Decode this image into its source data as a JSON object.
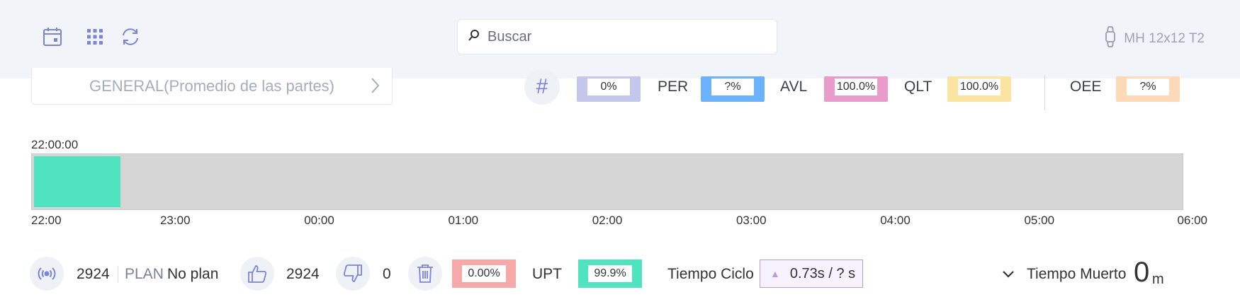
{
  "header": {
    "search_placeholder": "Buscar",
    "device_name": "MH 12x12 T2",
    "icons": [
      "calendar-icon",
      "grid-icon",
      "refresh-icon",
      "search-icon",
      "watch-icon"
    ]
  },
  "part_selector": {
    "label": "GENERAL(Promedio de las partes)"
  },
  "metrics": {
    "hash_symbol": "#",
    "count_value": "0%",
    "per_label": "PER",
    "per_value": "?%",
    "avl_label": "AVL",
    "avl_value": "100.0%",
    "qlt_label": "QLT",
    "qlt_value": "100.0%",
    "oee_label": "OEE",
    "oee_value": "?%",
    "colors": {
      "count": "#c5c6ec",
      "per": "#6bb1fb",
      "avl": "#e99ccb",
      "qlt": "#fbe3a1",
      "oee": "#fdd9b8"
    }
  },
  "timeline": {
    "start_label": "22:00:00",
    "ticks": [
      "22:00",
      "23:00",
      "00:00",
      "01:00",
      "02:00",
      "03:00",
      "04:00",
      "05:00",
      "06:00"
    ],
    "segment_color": "#4fe3bf",
    "segment_start_hours": 0.0,
    "segment_end_hours": 0.6,
    "span_hours": 8
  },
  "bottom": {
    "total": "2924",
    "plan_label": "PLAN",
    "plan_value": "No plan",
    "good": "2924",
    "bad": "0",
    "scrap_pct": "0.00%",
    "upt_label": "UPT",
    "upt_value": "99.9%",
    "cycle_label": "Tiempo Ciclo",
    "cycle_arrow": "▲",
    "cycle_value": "0.73s  /  ? s",
    "dead_label": "Tiempo Muerto",
    "dead_value": "0",
    "dead_unit": "m",
    "colors": {
      "scrap": "#f7a8a8",
      "upt": "#4fe3bf"
    }
  }
}
